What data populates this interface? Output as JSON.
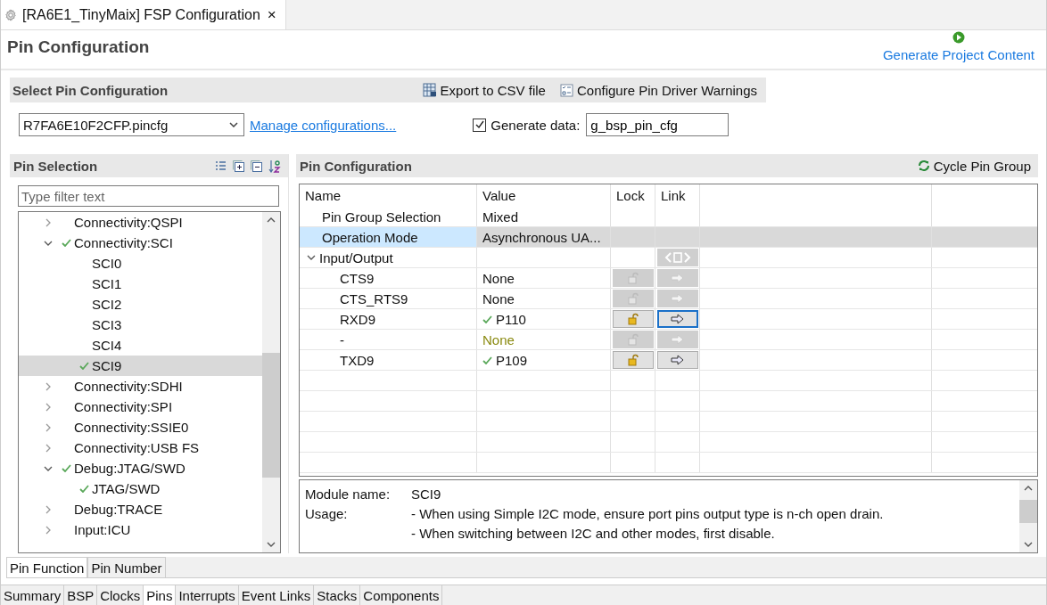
{
  "editor_tab": {
    "title": "[RA6E1_TinyMaix] FSP Configuration",
    "close": "×"
  },
  "page_title": "Pin Configuration",
  "generate_link": "Generate Project Content",
  "select_section": {
    "title": "Select Pin Configuration",
    "export_button": "Export to CSV file",
    "warnings_button": "Configure Pin Driver Warnings",
    "config_file": "R7FA6E10F2CFP.pincfg",
    "manage_link": "Manage configurations...",
    "generate_data": {
      "label": "Generate data:",
      "checked": true,
      "value": "g_bsp_pin_cfg"
    }
  },
  "pin_selection": {
    "title": "Pin Selection",
    "filter_placeholder": "Type filter text",
    "tree": [
      {
        "label": "Connectivity:QSPI",
        "expanded": false,
        "checked": false,
        "selected": false
      },
      {
        "label": "Connectivity:SCI",
        "expanded": true,
        "checked": true,
        "selected": false,
        "children": [
          {
            "label": "SCI0",
            "checked": false,
            "selected": false
          },
          {
            "label": "SCI1",
            "checked": false,
            "selected": false
          },
          {
            "label": "SCI2",
            "checked": false,
            "selected": false
          },
          {
            "label": "SCI3",
            "checked": false,
            "selected": false
          },
          {
            "label": "SCI4",
            "checked": false,
            "selected": false
          },
          {
            "label": "SCI9",
            "checked": true,
            "selected": true
          }
        ]
      },
      {
        "label": "Connectivity:SDHI",
        "expanded": false,
        "checked": false,
        "selected": false
      },
      {
        "label": "Connectivity:SPI",
        "expanded": false,
        "checked": false,
        "selected": false
      },
      {
        "label": "Connectivity:SSIE0",
        "expanded": false,
        "checked": false,
        "selected": false
      },
      {
        "label": "Connectivity:USB FS",
        "expanded": false,
        "checked": false,
        "selected": false
      },
      {
        "label": "Debug:JTAG/SWD",
        "expanded": true,
        "checked": true,
        "selected": false,
        "children": [
          {
            "label": "JTAG/SWD",
            "checked": true,
            "selected": false
          }
        ]
      },
      {
        "label": "Debug:TRACE",
        "expanded": false,
        "checked": false,
        "selected": false
      },
      {
        "label": "Input:ICU",
        "expanded": false,
        "checked": false,
        "selected": false
      }
    ]
  },
  "pin_configuration": {
    "title": "Pin Configuration",
    "cycle_button": "Cycle Pin Group",
    "columns": [
      "Name",
      "Value",
      "Lock",
      "Link"
    ],
    "rows": [
      {
        "kind": "property",
        "name": "Pin Group Selection",
        "value": "Mixed",
        "selected": false
      },
      {
        "kind": "property",
        "name": "Operation Mode",
        "value": "Asynchronous UA...",
        "selected": true
      },
      {
        "kind": "group",
        "name": "Input/Output",
        "expanded": true,
        "selected": false,
        "link_all_enabled": false,
        "children": [
          {
            "name": "CTS9",
            "value": "None",
            "checked": false,
            "unassigned": false,
            "lock_enabled": false,
            "link_enabled": false,
            "focused": false
          },
          {
            "name": "CTS_RTS9",
            "value": "None",
            "checked": false,
            "unassigned": false,
            "lock_enabled": false,
            "link_enabled": false,
            "focused": false
          },
          {
            "name": "RXD9",
            "value": "P110",
            "checked": true,
            "unassigned": false,
            "lock_enabled": true,
            "link_enabled": true,
            "focused": true
          },
          {
            "name": "-",
            "value": "None",
            "checked": false,
            "unassigned": true,
            "lock_enabled": false,
            "link_enabled": false,
            "focused": false
          },
          {
            "name": "TXD9",
            "value": "P109",
            "checked": true,
            "unassigned": false,
            "lock_enabled": true,
            "link_enabled": true,
            "focused": false
          }
        ]
      }
    ],
    "info": {
      "module_label": "Module name:",
      "module_value": "SCI9",
      "usage_label": "Usage:",
      "usage_lines": [
        "- When using Simple I2C mode, ensure port pins output type is n-ch open drain.",
        "- When switching between I2C and other modes, first disable."
      ]
    }
  },
  "view_tabs": [
    {
      "label": "Pin Function",
      "selected": true
    },
    {
      "label": "Pin Number",
      "selected": false
    }
  ],
  "editor_pages": [
    {
      "label": "Summary",
      "selected": false
    },
    {
      "label": "BSP",
      "selected": false
    },
    {
      "label": "Clocks",
      "selected": false
    },
    {
      "label": "Pins",
      "selected": true
    },
    {
      "label": "Interrupts",
      "selected": false
    },
    {
      "label": "Event Links",
      "selected": false
    },
    {
      "label": "Stacks",
      "selected": false
    },
    {
      "label": "Components",
      "selected": false
    }
  ]
}
